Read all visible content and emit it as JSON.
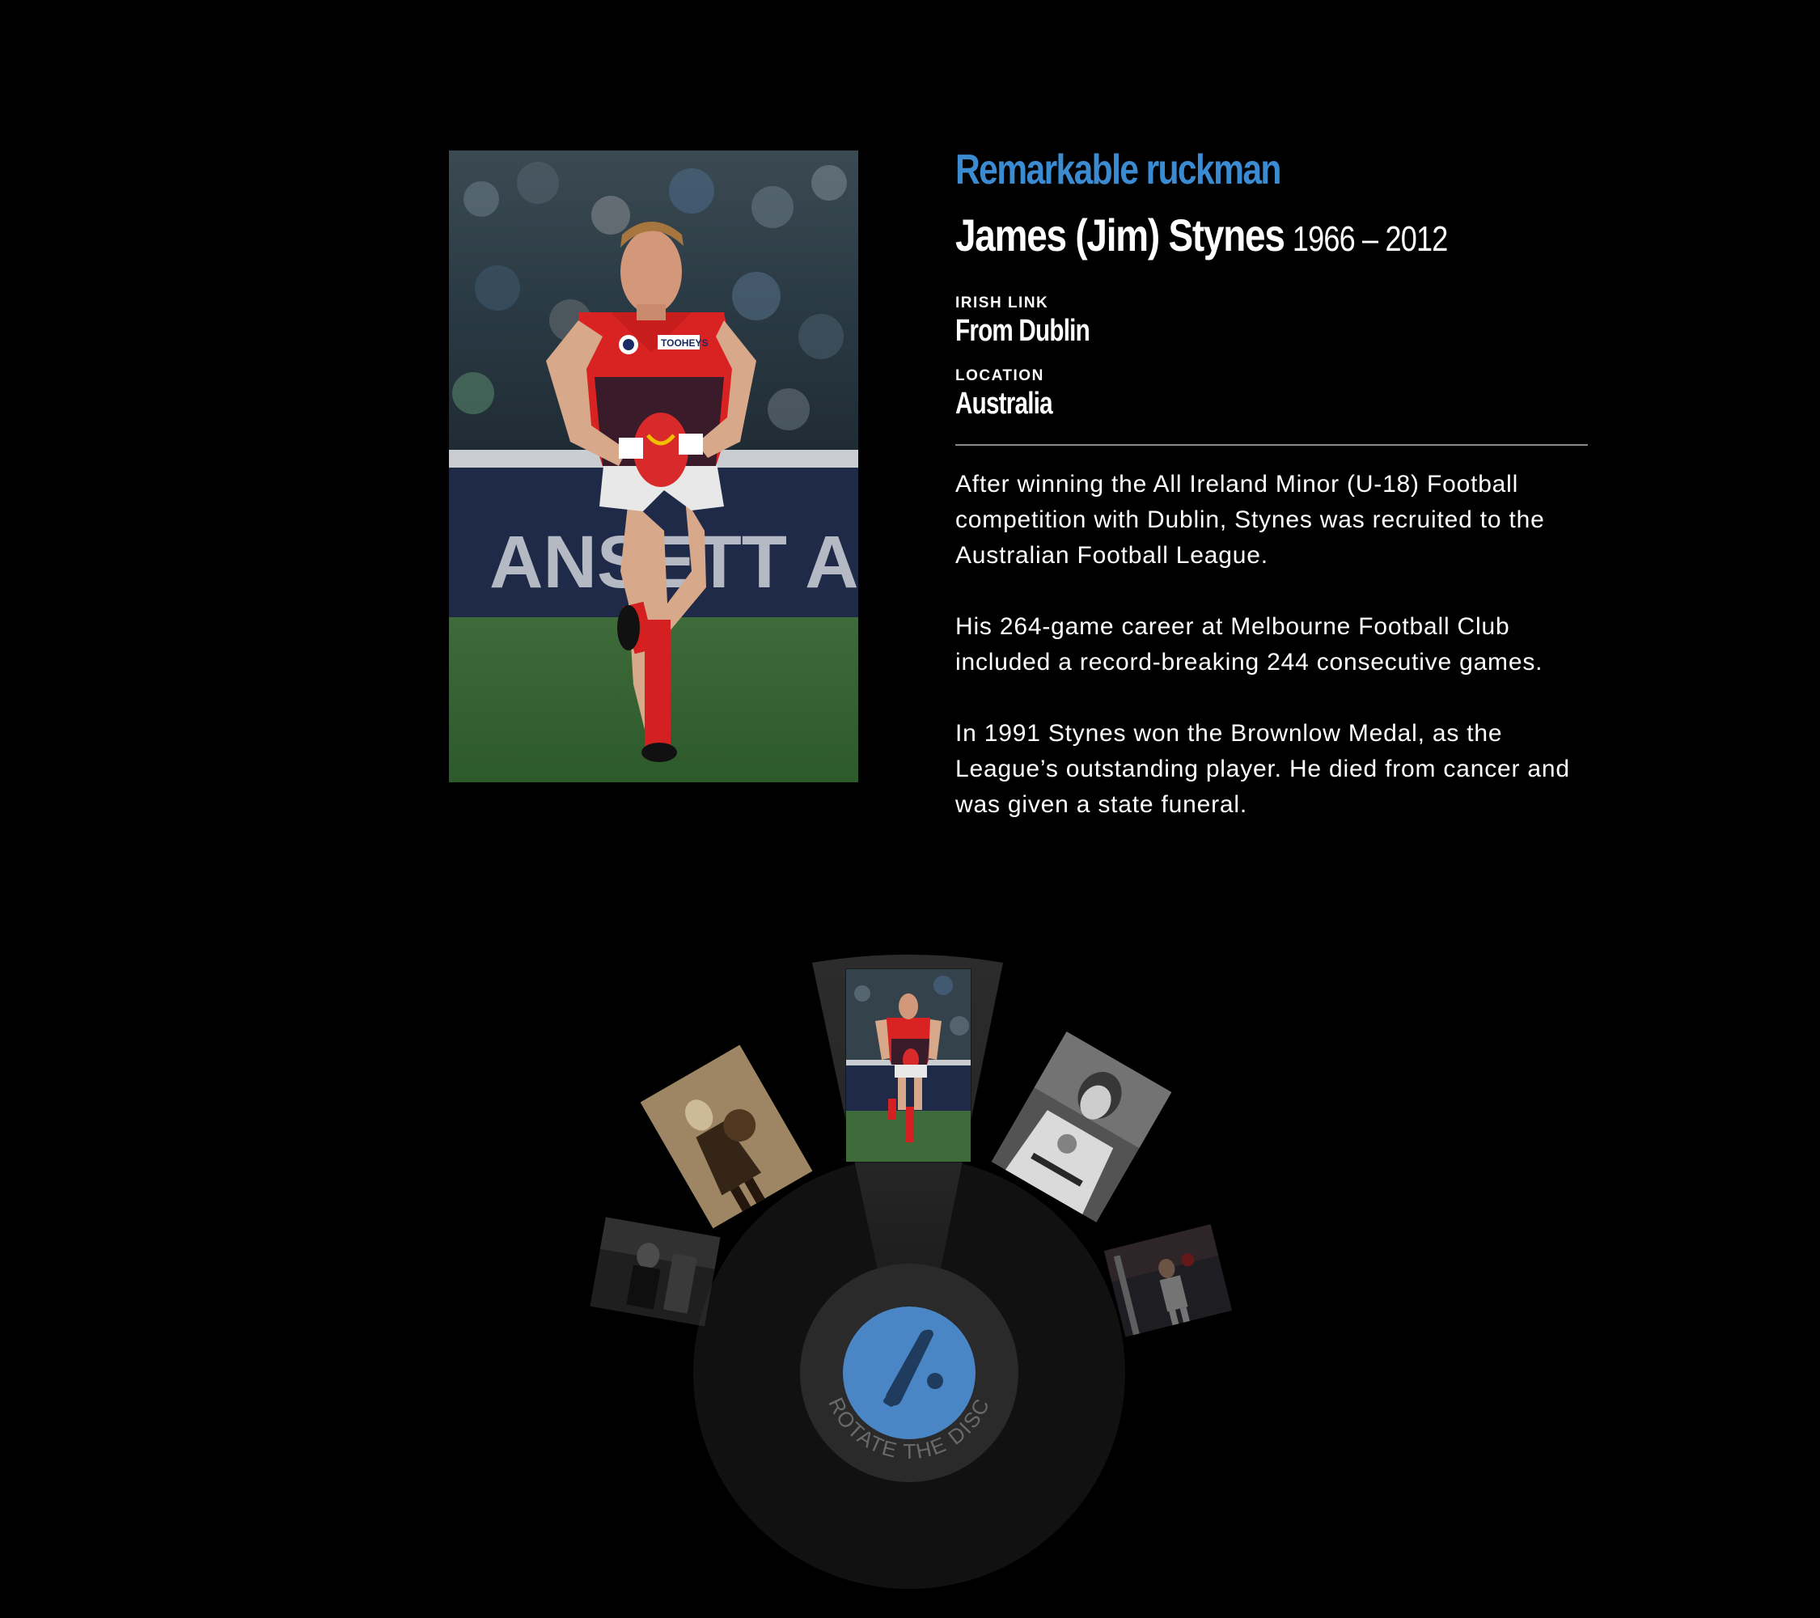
{
  "feature": {
    "headline": "Remarkable ruckman",
    "name": "James (Jim) Stynes",
    "years": "1966 – 2012",
    "irish_link_label": "IRISH LINK",
    "irish_link_value": "From Dublin",
    "location_label": "LOCATION",
    "location_value": "Australia",
    "paragraphs": [
      "After winning the All Ireland Minor (U-18) Football competition with Dublin, Stynes was recruited to the Australian Football League.",
      "His 264-game career at Melbourne Football Club included a record-breaking 244 consecutive games.",
      "In 1991 Stynes won the Brownlow Medal, as the League’s outstanding player. He died from cancer and was given a state funeral."
    ],
    "photo_banner_text": "ANSETT AUSTRA",
    "jersey_text": "TOOHEYS"
  },
  "disc": {
    "center_label": "ROTATE THE DISC",
    "center_icon": "baseball-bat-icon",
    "thumbnails": [
      {
        "name": "thumb-far-left",
        "tone": "grayscale",
        "selected": false
      },
      {
        "name": "thumb-left",
        "tone": "sepia",
        "selected": false
      },
      {
        "name": "thumb-center",
        "tone": "color",
        "selected": true
      },
      {
        "name": "thumb-right",
        "tone": "grayscale",
        "selected": false
      },
      {
        "name": "thumb-far-right",
        "tone": "faded-color",
        "selected": false
      }
    ]
  },
  "colors": {
    "accent": "#3a8bd1",
    "background": "#000000",
    "disc_button": "#4a86c6",
    "disc_ring": "#2a2a2a",
    "disc_body": "#111111"
  }
}
